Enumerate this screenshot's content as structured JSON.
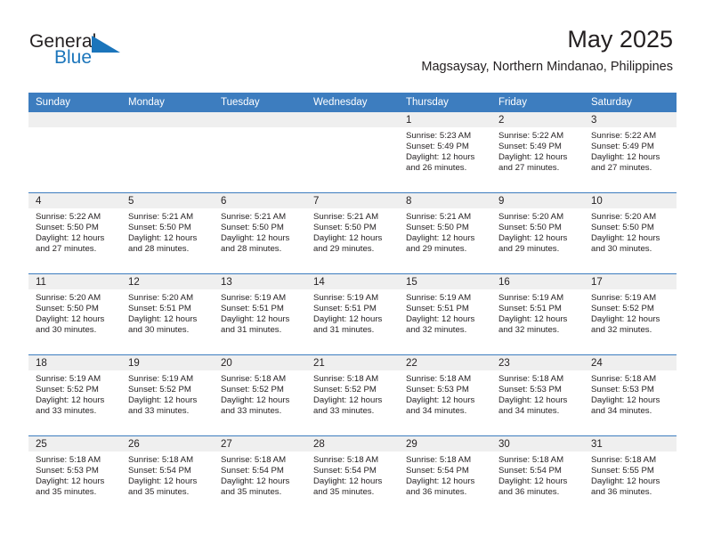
{
  "brand": {
    "name_line1": "General",
    "name_line2": "Blue",
    "flag_icon": "triangle-flag-icon",
    "color_primary": "#1b75bb"
  },
  "header": {
    "month_title": "May 2025",
    "location": "Magsaysay, Northern Mindanao, Philippines"
  },
  "calendar": {
    "header_color": "#3d7dbf",
    "daynum_bg": "#efefef",
    "weekday_headers": [
      "Sunday",
      "Monday",
      "Tuesday",
      "Wednesday",
      "Thursday",
      "Friday",
      "Saturday"
    ],
    "weeks": [
      [
        {
          "day": "",
          "blank": true
        },
        {
          "day": "",
          "blank": true
        },
        {
          "day": "",
          "blank": true
        },
        {
          "day": "",
          "blank": true
        },
        {
          "day": "1",
          "sunrise": "Sunrise: 5:23 AM",
          "sunset": "Sunset: 5:49 PM",
          "daylight_l1": "Daylight: 12 hours",
          "daylight_l2": "and 26 minutes."
        },
        {
          "day": "2",
          "sunrise": "Sunrise: 5:22 AM",
          "sunset": "Sunset: 5:49 PM",
          "daylight_l1": "Daylight: 12 hours",
          "daylight_l2": "and 27 minutes."
        },
        {
          "day": "3",
          "sunrise": "Sunrise: 5:22 AM",
          "sunset": "Sunset: 5:49 PM",
          "daylight_l1": "Daylight: 12 hours",
          "daylight_l2": "and 27 minutes."
        }
      ],
      [
        {
          "day": "4",
          "sunrise": "Sunrise: 5:22 AM",
          "sunset": "Sunset: 5:50 PM",
          "daylight_l1": "Daylight: 12 hours",
          "daylight_l2": "and 27 minutes."
        },
        {
          "day": "5",
          "sunrise": "Sunrise: 5:21 AM",
          "sunset": "Sunset: 5:50 PM",
          "daylight_l1": "Daylight: 12 hours",
          "daylight_l2": "and 28 minutes."
        },
        {
          "day": "6",
          "sunrise": "Sunrise: 5:21 AM",
          "sunset": "Sunset: 5:50 PM",
          "daylight_l1": "Daylight: 12 hours",
          "daylight_l2": "and 28 minutes."
        },
        {
          "day": "7",
          "sunrise": "Sunrise: 5:21 AM",
          "sunset": "Sunset: 5:50 PM",
          "daylight_l1": "Daylight: 12 hours",
          "daylight_l2": "and 29 minutes."
        },
        {
          "day": "8",
          "sunrise": "Sunrise: 5:21 AM",
          "sunset": "Sunset: 5:50 PM",
          "daylight_l1": "Daylight: 12 hours",
          "daylight_l2": "and 29 minutes."
        },
        {
          "day": "9",
          "sunrise": "Sunrise: 5:20 AM",
          "sunset": "Sunset: 5:50 PM",
          "daylight_l1": "Daylight: 12 hours",
          "daylight_l2": "and 29 minutes."
        },
        {
          "day": "10",
          "sunrise": "Sunrise: 5:20 AM",
          "sunset": "Sunset: 5:50 PM",
          "daylight_l1": "Daylight: 12 hours",
          "daylight_l2": "and 30 minutes."
        }
      ],
      [
        {
          "day": "11",
          "sunrise": "Sunrise: 5:20 AM",
          "sunset": "Sunset: 5:50 PM",
          "daylight_l1": "Daylight: 12 hours",
          "daylight_l2": "and 30 minutes."
        },
        {
          "day": "12",
          "sunrise": "Sunrise: 5:20 AM",
          "sunset": "Sunset: 5:51 PM",
          "daylight_l1": "Daylight: 12 hours",
          "daylight_l2": "and 30 minutes."
        },
        {
          "day": "13",
          "sunrise": "Sunrise: 5:19 AM",
          "sunset": "Sunset: 5:51 PM",
          "daylight_l1": "Daylight: 12 hours",
          "daylight_l2": "and 31 minutes."
        },
        {
          "day": "14",
          "sunrise": "Sunrise: 5:19 AM",
          "sunset": "Sunset: 5:51 PM",
          "daylight_l1": "Daylight: 12 hours",
          "daylight_l2": "and 31 minutes."
        },
        {
          "day": "15",
          "sunrise": "Sunrise: 5:19 AM",
          "sunset": "Sunset: 5:51 PM",
          "daylight_l1": "Daylight: 12 hours",
          "daylight_l2": "and 32 minutes."
        },
        {
          "day": "16",
          "sunrise": "Sunrise: 5:19 AM",
          "sunset": "Sunset: 5:51 PM",
          "daylight_l1": "Daylight: 12 hours",
          "daylight_l2": "and 32 minutes."
        },
        {
          "day": "17",
          "sunrise": "Sunrise: 5:19 AM",
          "sunset": "Sunset: 5:52 PM",
          "daylight_l1": "Daylight: 12 hours",
          "daylight_l2": "and 32 minutes."
        }
      ],
      [
        {
          "day": "18",
          "sunrise": "Sunrise: 5:19 AM",
          "sunset": "Sunset: 5:52 PM",
          "daylight_l1": "Daylight: 12 hours",
          "daylight_l2": "and 33 minutes."
        },
        {
          "day": "19",
          "sunrise": "Sunrise: 5:19 AM",
          "sunset": "Sunset: 5:52 PM",
          "daylight_l1": "Daylight: 12 hours",
          "daylight_l2": "and 33 minutes."
        },
        {
          "day": "20",
          "sunrise": "Sunrise: 5:18 AM",
          "sunset": "Sunset: 5:52 PM",
          "daylight_l1": "Daylight: 12 hours",
          "daylight_l2": "and 33 minutes."
        },
        {
          "day": "21",
          "sunrise": "Sunrise: 5:18 AM",
          "sunset": "Sunset: 5:52 PM",
          "daylight_l1": "Daylight: 12 hours",
          "daylight_l2": "and 33 minutes."
        },
        {
          "day": "22",
          "sunrise": "Sunrise: 5:18 AM",
          "sunset": "Sunset: 5:53 PM",
          "daylight_l1": "Daylight: 12 hours",
          "daylight_l2": "and 34 minutes."
        },
        {
          "day": "23",
          "sunrise": "Sunrise: 5:18 AM",
          "sunset": "Sunset: 5:53 PM",
          "daylight_l1": "Daylight: 12 hours",
          "daylight_l2": "and 34 minutes."
        },
        {
          "day": "24",
          "sunrise": "Sunrise: 5:18 AM",
          "sunset": "Sunset: 5:53 PM",
          "daylight_l1": "Daylight: 12 hours",
          "daylight_l2": "and 34 minutes."
        }
      ],
      [
        {
          "day": "25",
          "sunrise": "Sunrise: 5:18 AM",
          "sunset": "Sunset: 5:53 PM",
          "daylight_l1": "Daylight: 12 hours",
          "daylight_l2": "and 35 minutes."
        },
        {
          "day": "26",
          "sunrise": "Sunrise: 5:18 AM",
          "sunset": "Sunset: 5:54 PM",
          "daylight_l1": "Daylight: 12 hours",
          "daylight_l2": "and 35 minutes."
        },
        {
          "day": "27",
          "sunrise": "Sunrise: 5:18 AM",
          "sunset": "Sunset: 5:54 PM",
          "daylight_l1": "Daylight: 12 hours",
          "daylight_l2": "and 35 minutes."
        },
        {
          "day": "28",
          "sunrise": "Sunrise: 5:18 AM",
          "sunset": "Sunset: 5:54 PM",
          "daylight_l1": "Daylight: 12 hours",
          "daylight_l2": "and 35 minutes."
        },
        {
          "day": "29",
          "sunrise": "Sunrise: 5:18 AM",
          "sunset": "Sunset: 5:54 PM",
          "daylight_l1": "Daylight: 12 hours",
          "daylight_l2": "and 36 minutes."
        },
        {
          "day": "30",
          "sunrise": "Sunrise: 5:18 AM",
          "sunset": "Sunset: 5:54 PM",
          "daylight_l1": "Daylight: 12 hours",
          "daylight_l2": "and 36 minutes."
        },
        {
          "day": "31",
          "sunrise": "Sunrise: 5:18 AM",
          "sunset": "Sunset: 5:55 PM",
          "daylight_l1": "Daylight: 12 hours",
          "daylight_l2": "and 36 minutes."
        }
      ]
    ]
  }
}
